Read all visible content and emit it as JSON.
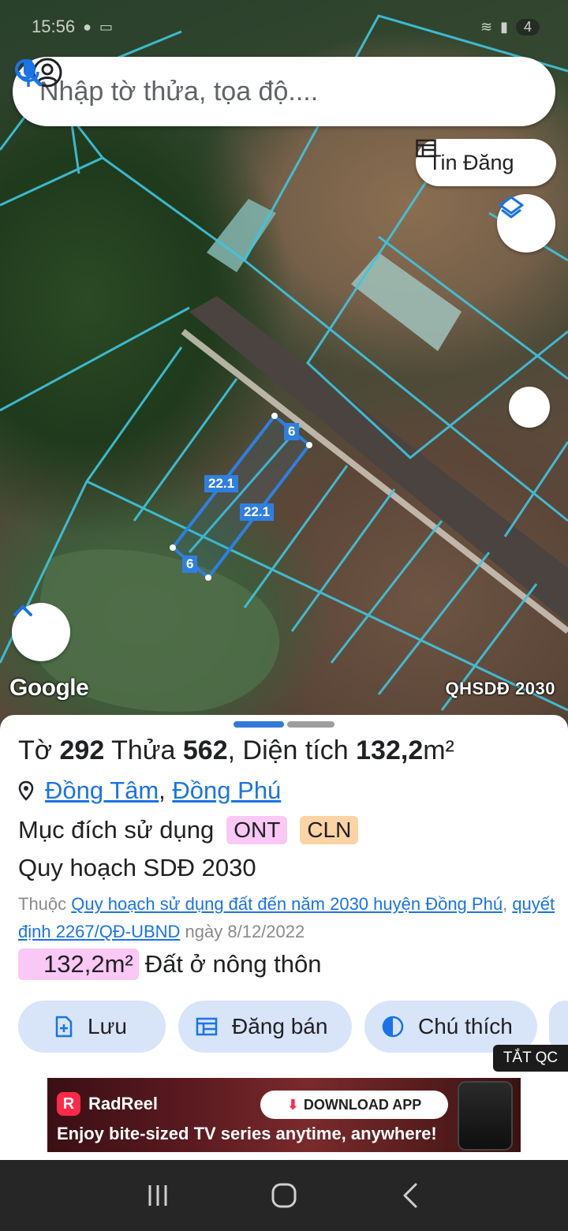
{
  "status_bar": {
    "time": "15:56",
    "battery": "4"
  },
  "search": {
    "placeholder": "Nhập tờ thửa, tọa độ...."
  },
  "map": {
    "tin_dang_label": "Tin Đăng",
    "plot_labels": {
      "top_short": "6",
      "left_long": "22.1",
      "right_long": "22.1",
      "bottom_short": "6"
    },
    "google_label": "Google",
    "layer_label": "QHSDĐ 2030"
  },
  "sheet": {
    "title": {
      "prefix_to": "Tờ ",
      "to_num": "292",
      "prefix_thua": " Thửa ",
      "thua_num": "562",
      "prefix_area": ", Diện tích ",
      "area": "132,2",
      "unit": "m²"
    },
    "location": {
      "commune": "Đồng Tâm",
      "separator": ",",
      "district": "Đồng Phú"
    },
    "purpose": {
      "label": "Mục đích sử dụng",
      "tags": [
        "ONT",
        "CLN"
      ]
    },
    "plan": {
      "title": "Quy hoạch SDĐ 2030",
      "desc_prefix": "Thuộc ",
      "desc_link1": "Quy hoạch sử dụng đất đến năm 2030 huyện Đồng Phú",
      "desc_comma": ",",
      "desc_link2": "quyết định 2267/QĐ-UBND",
      "desc_suffix": " ngày 8/12/2022"
    },
    "area_row": {
      "value": "132,2m²",
      "label": "Đất ở nông thôn"
    },
    "actions": {
      "save": "Lưu",
      "post": "Đăng bán",
      "legend": "Chú thích"
    }
  },
  "ad": {
    "close_label": "TẮT QC",
    "brand": "RadReel",
    "cta": "DOWNLOAD APP",
    "tagline": "Enjoy bite-sized TV series anytime, anywhere!"
  },
  "colors": {
    "accent": "#1a73e8",
    "parcel_line": "#2f7fe0",
    "cadastral_line": "#3fc6e0",
    "ont_tag": "#fac8f5",
    "cln_tag": "#fbd3a4"
  }
}
